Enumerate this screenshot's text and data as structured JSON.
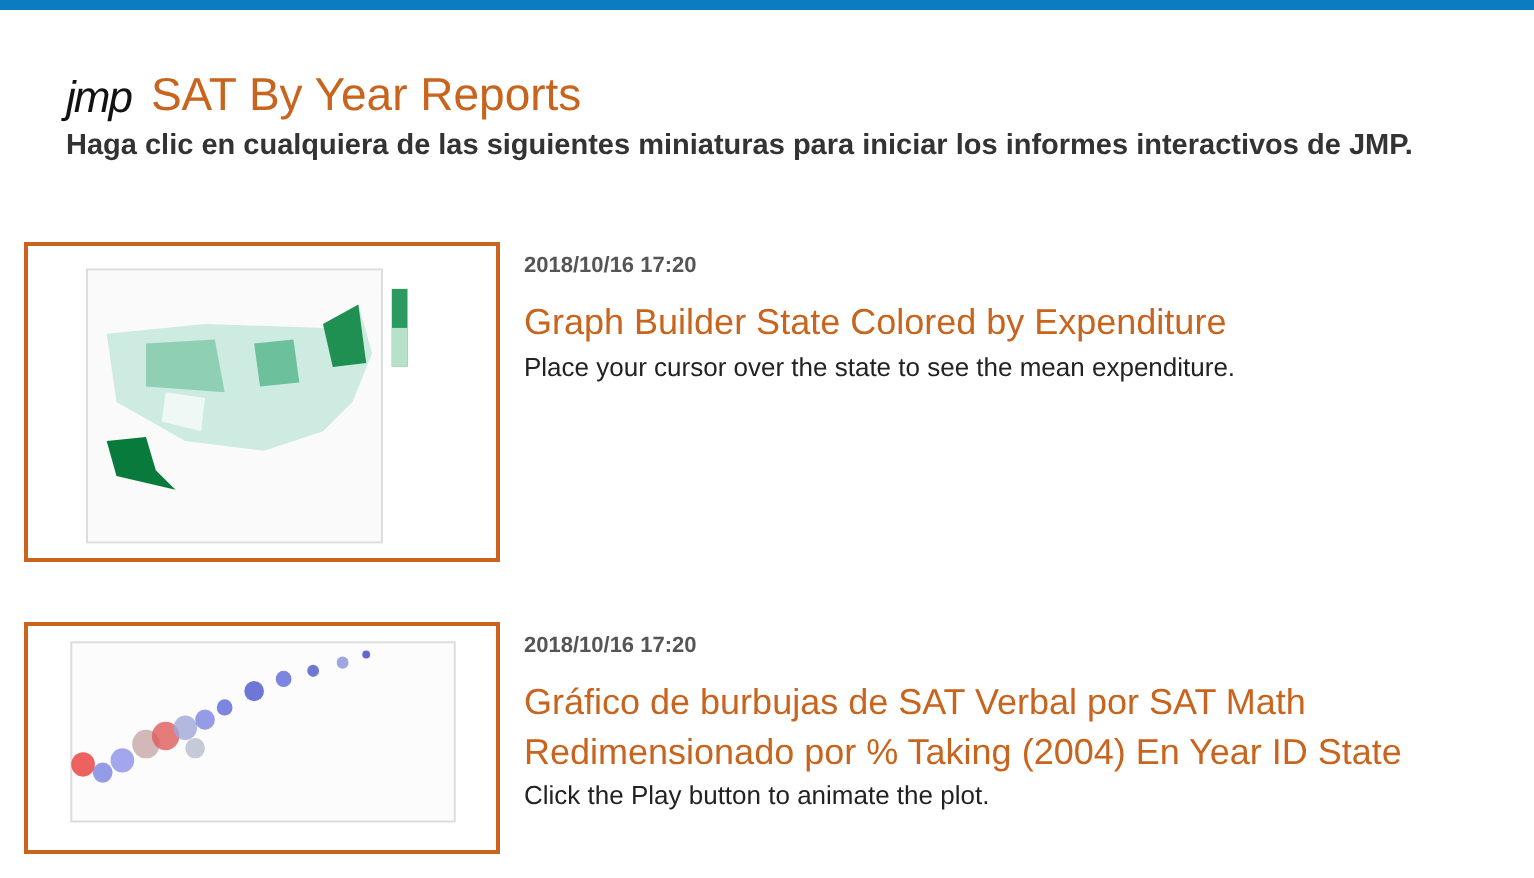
{
  "header": {
    "logo": "jmp",
    "title": "SAT By Year Reports",
    "subtitle": "Haga clic en cualquiera de las siguientes miniaturas para iniciar los informes interactivos de JMP."
  },
  "reports": [
    {
      "date": "2018/10/16 17:20",
      "title": "Graph Builder State Colored by Expenditure",
      "description": "Place your cursor over the state to see the mean expenditure."
    },
    {
      "date": "2018/10/16 17:20",
      "title": "Gráfico de burbujas de SAT Verbal por SAT Math Redimensionado por % Taking (2004) En Year ID State",
      "description": "Click the Play button to animate the plot."
    }
  ]
}
